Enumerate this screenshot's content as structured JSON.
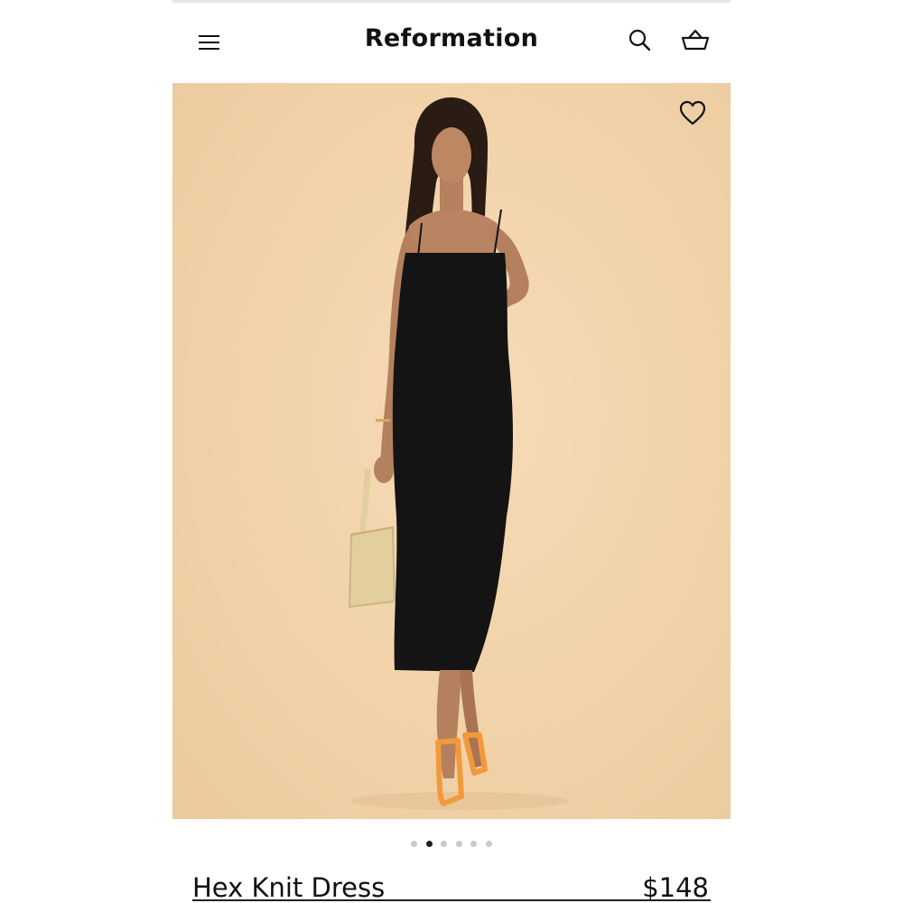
{
  "header": {
    "brand": "Reformation",
    "menu_icon": "hamburger-menu-icon",
    "search_icon": "search-icon",
    "bag_icon": "shopping-basket-icon"
  },
  "hero": {
    "favorite_icon": "heart-outline-icon",
    "image_subject": "photo",
    "background_color": "#f1d2a9"
  },
  "carousel": {
    "total": 6,
    "active_index": 1
  },
  "product": {
    "name": "Hex Knit Dress",
    "price": "$148"
  },
  "colors": {
    "text": "#111111",
    "dress": "#141414",
    "sandal": "#f29a3b",
    "bag": "#e3cf9e"
  }
}
